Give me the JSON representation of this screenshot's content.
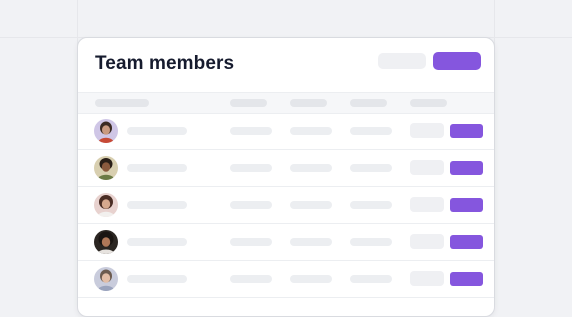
{
  "card": {
    "title": "Team members"
  },
  "colors": {
    "accent": "#8556de",
    "background": "#f1f2f5",
    "card": "#ffffff",
    "skeleton": "#eceef1",
    "title": "#161b2e"
  },
  "members": [
    {
      "avatar": "avatar-photo-1"
    },
    {
      "avatar": "avatar-photo-2"
    },
    {
      "avatar": "avatar-photo-3"
    },
    {
      "avatar": "avatar-photo-4"
    },
    {
      "avatar": "avatar-photo-5"
    }
  ]
}
